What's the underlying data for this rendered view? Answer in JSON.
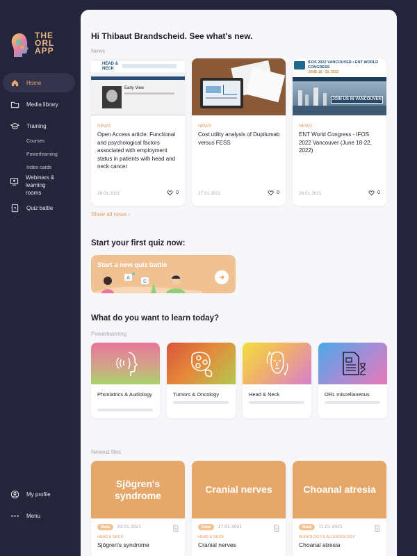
{
  "app": {
    "logo_line1": "THE",
    "logo_line2": "ORL",
    "logo_line3": "APP"
  },
  "sidebar": {
    "items": [
      {
        "label": "Home",
        "icon": "home-icon",
        "active": true
      },
      {
        "label": "Media library",
        "icon": "folder-icon"
      },
      {
        "label": "Training",
        "icon": "graduation-cap-icon"
      },
      {
        "label": "Webinars & learning rooms",
        "icon": "webinar-icon"
      },
      {
        "label": "Quiz battle",
        "icon": "quiz-icon"
      }
    ],
    "training_sub": [
      "Courses",
      "Powerlearning",
      "Index cards"
    ],
    "bottom": [
      {
        "label": "My profile",
        "icon": "user-icon"
      },
      {
        "label": "Menu",
        "icon": "more-dots-icon"
      }
    ]
  },
  "main": {
    "greeting": "Hi Thibaut Brandscheid. See what's new.",
    "news_label": "News",
    "news": [
      {
        "tag": "NEWS",
        "title": "Open Access article: Functional and psychological factors associated with employment status in patients with head and neck cancer",
        "date": "28.01.2021",
        "likes": "0",
        "img_head": "HEAD & NECK",
        "img_caption": "Early View"
      },
      {
        "tag": "NEWS",
        "title": "Cost utility analysis of Dupilumab versus FESS",
        "date": "27.01.2021",
        "likes": "0"
      },
      {
        "tag": "NEWS",
        "title": "ENT World Congress - IFOS 2022 Vancouver (June 18-22, 2022)",
        "date": "26.01.2021",
        "likes": "0",
        "img_head": "IFOS 2022 VANCOUVER • ENT WORLD CONGRESS",
        "img_sub": "JUNE 18 - 22, 2022",
        "img_caption": "JOIN US IN VANCOUVER"
      }
    ],
    "show_all": "Show all news",
    "quiz_heading": "Start your first quiz now:",
    "quiz_banner": "Start a new quiz battle",
    "learn_heading": "What do you want to learn today?",
    "powerlearning_label": "Powerlearning",
    "powerlearning": [
      {
        "label": "Phoniatrics & Audiology",
        "icon": "throat-icon",
        "progress": 0
      },
      {
        "label": "Tumors & Oncology",
        "icon": "cells-icon",
        "progress": 0
      },
      {
        "label": "Head & Neck",
        "icon": "face-icon",
        "progress": 0
      },
      {
        "label": "ORL miscellaneous",
        "icon": "document-hourglass-icon",
        "progress": 0
      }
    ],
    "files_label": "Newest files",
    "files": [
      {
        "cover": "Sjögren's syndrome",
        "badge": "New",
        "date": "23.01.2021",
        "category": "HEAD & NECK",
        "title": "Sjögren's syndrome"
      },
      {
        "cover": "Cranial nerves",
        "badge": "New",
        "date": "17.01.2021",
        "category": "HEAD & NECK",
        "title": "Cranial nerves"
      },
      {
        "cover": "Choanal atresia",
        "badge": "New",
        "date": "11.01.2021",
        "category": "RHINOLOGY & ALLERGOLOGY",
        "title": "Choanal atresia"
      }
    ]
  },
  "colors": {
    "sidebar_bg": "#24243a",
    "accent": "#e29a5b",
    "file_cover": "#e6a86a",
    "quiz_banner": "#f0c293"
  }
}
